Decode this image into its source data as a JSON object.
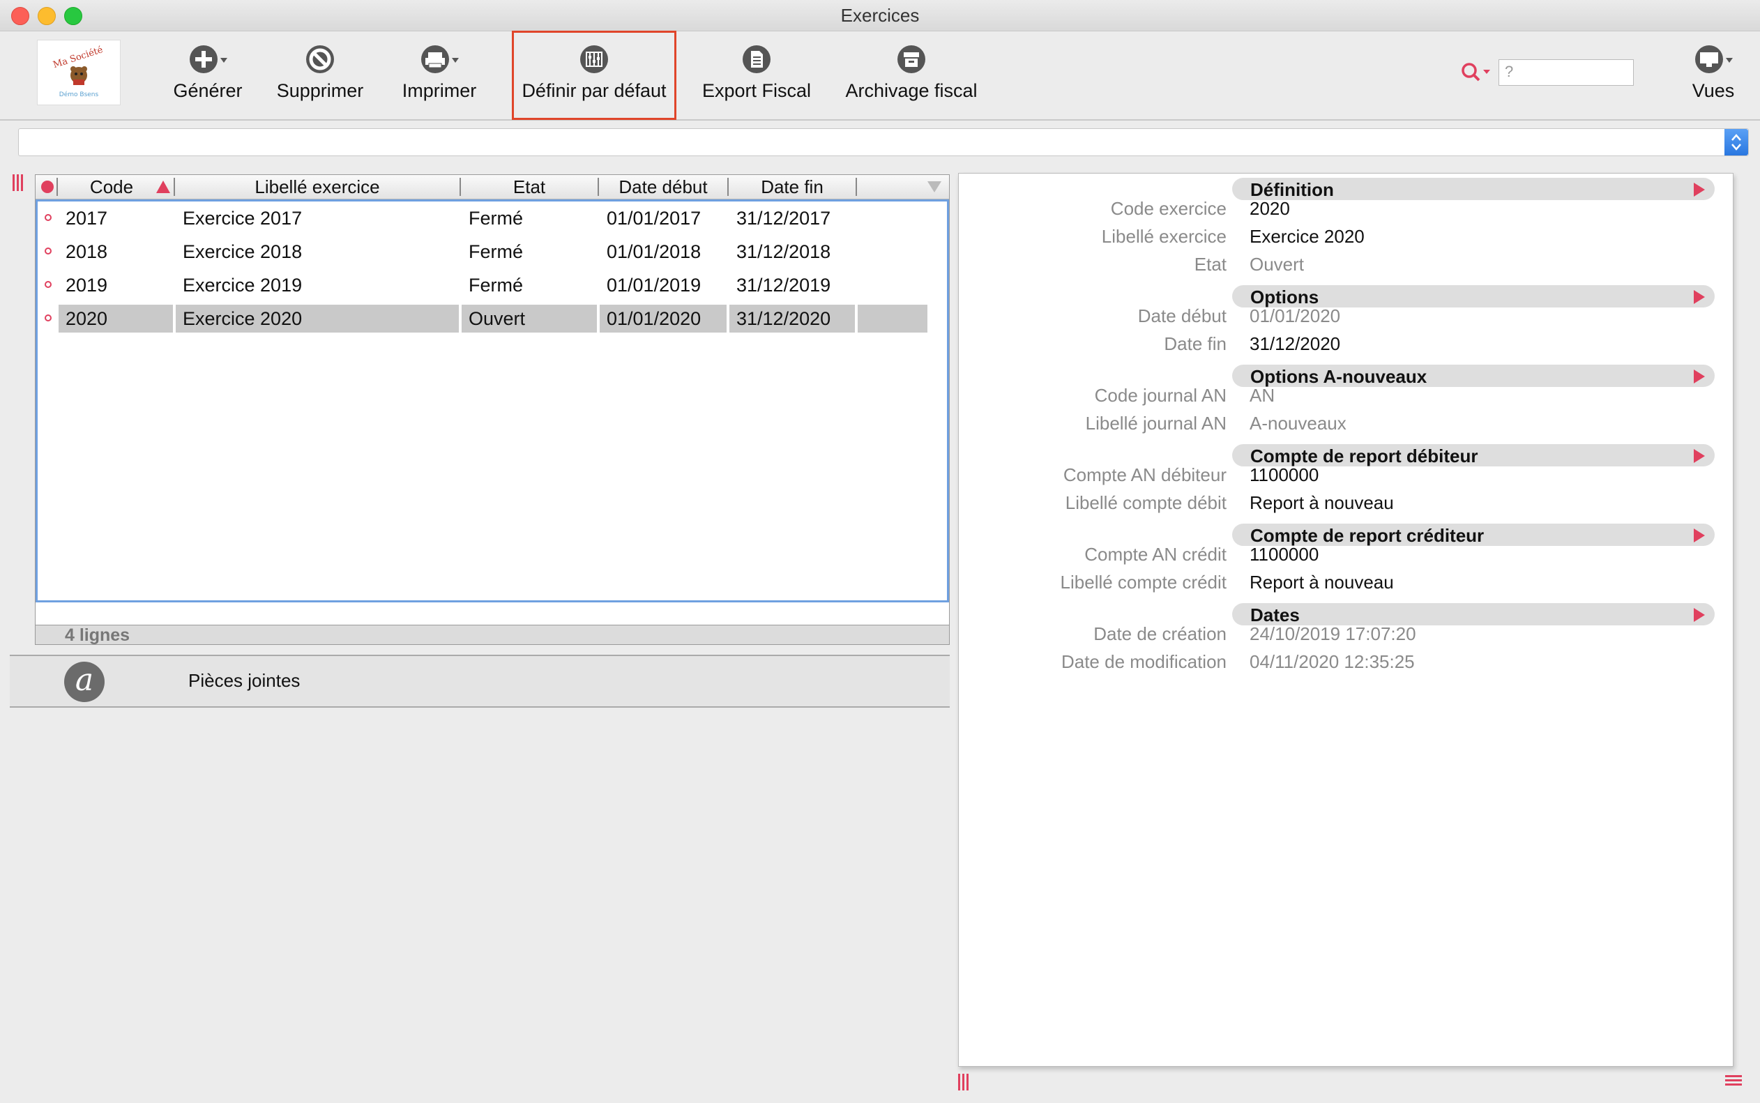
{
  "window": {
    "title": "Exercices"
  },
  "logo": {
    "line1": "Ma Société",
    "line2": "Démo Bsens"
  },
  "toolbar": {
    "generate": "Générer",
    "delete": "Supprimer",
    "print": "Imprimer",
    "set_default": "Définir par défaut",
    "export_fiscal": "Export Fiscal",
    "archive_fiscal": "Archivage fiscal",
    "views": "Vues",
    "search_placeholder": "?"
  },
  "table": {
    "headers": [
      "Code",
      "Libellé exercice",
      "Etat",
      "Date début",
      "Date fin"
    ],
    "rows": [
      {
        "code": "2017",
        "label": "Exercice 2017",
        "state": "Fermé",
        "start": "01/01/2017",
        "end": "31/12/2017"
      },
      {
        "code": "2018",
        "label": "Exercice 2018",
        "state": "Fermé",
        "start": "01/01/2018",
        "end": "31/12/2018"
      },
      {
        "code": "2019",
        "label": "Exercice 2019",
        "state": "Fermé",
        "start": "01/01/2019",
        "end": "31/12/2019"
      },
      {
        "code": "2020",
        "label": "Exercice 2020",
        "state": "Ouvert",
        "start": "01/01/2020",
        "end": "31/12/2020"
      }
    ],
    "selected_row": 3,
    "count": "4 lignes"
  },
  "attachments": {
    "label": "Pièces jointes"
  },
  "detail": {
    "sections": [
      {
        "title": "Définition",
        "fields": [
          {
            "label": "Code exercice",
            "value": "2020"
          },
          {
            "label": "Libellé exercice",
            "value": "Exercice 2020"
          },
          {
            "label": "Etat",
            "value": "Ouvert"
          }
        ]
      },
      {
        "title": "Options",
        "fields": [
          {
            "label": "Date début",
            "value": "01/01/2020"
          },
          {
            "label": "Date fin",
            "value": "31/12/2020"
          }
        ]
      },
      {
        "title": "Options A-nouveaux",
        "fields": [
          {
            "label": "Code journal AN",
            "value": "AN"
          },
          {
            "label": "Libellé journal AN",
            "value": "A-nouveaux"
          }
        ]
      },
      {
        "title": "Compte de report débiteur",
        "fields": [
          {
            "label": "Compte AN débiteur",
            "value": "1100000"
          },
          {
            "label": "Libellé compte débit",
            "value": "Report à nouveau"
          }
        ]
      },
      {
        "title": "Compte de report créditeur",
        "fields": [
          {
            "label": "Compte AN crédit",
            "value": "1100000"
          },
          {
            "label": "Libellé compte crédit",
            "value": "Report à nouveau"
          }
        ]
      },
      {
        "title": "Dates",
        "fields": [
          {
            "label": "Date de création",
            "value": "24/10/2019 17:07:20"
          },
          {
            "label": "Date de modification",
            "value": "04/11/2020 12:35:25"
          }
        ]
      }
    ]
  }
}
